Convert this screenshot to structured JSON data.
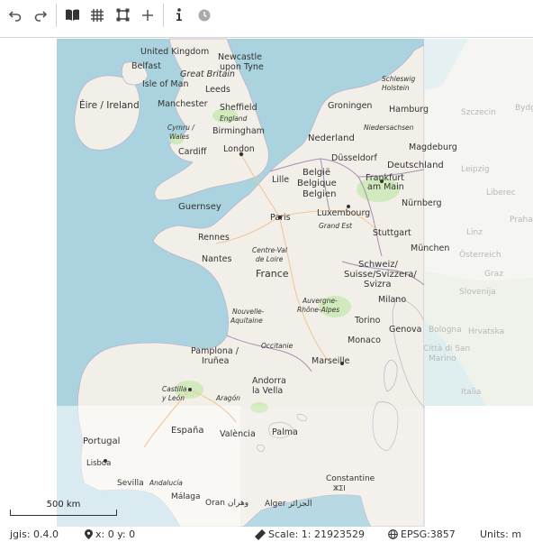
{
  "toolbar": {
    "buttons": [
      {
        "name": "undo-button",
        "icon": "undo-icon"
      },
      {
        "name": "redo-button",
        "icon": "redo-icon"
      },
      {
        "name": "layers-button",
        "icon": "book-open-icon"
      },
      {
        "name": "grid-button",
        "icon": "grid-icon"
      },
      {
        "name": "bounding-box-button",
        "icon": "vector-square-icon"
      },
      {
        "name": "add-button",
        "icon": "plus-icon"
      },
      {
        "name": "info-button",
        "icon": "info-icon"
      },
      {
        "name": "history-button",
        "icon": "clock-icon"
      }
    ]
  },
  "map": {
    "place_labels": {
      "united_kingdom": "United Kingdom",
      "great_britain": "Great Britain",
      "belfast": "Belfast",
      "newcastle": "Newcastle",
      "upon_tyne": "upon Tyne",
      "isle_of_man": "Isle of Man",
      "leeds": "Leeds",
      "eire": "Éire / Ireland",
      "manchester": "Manchester",
      "sheffield": "Sheffield",
      "england": "England",
      "cymru": "Cymru /",
      "wales": "Wales",
      "birmingham": "Birmingham",
      "cardiff": "Cardiff",
      "london": "London",
      "schleswig": "Schleswig",
      "holstein": "Holstein",
      "groningen": "Groningen",
      "hamburg": "Hamburg",
      "niedersachsen": "Niedersachsen",
      "nederland": "Nederland",
      "magdeburg": "Magdeburg",
      "dusseldorf": "Düsseldorf",
      "deutschland": "Deutschland",
      "belgie1": "België",
      "belgie2": "Belgique",
      "belgie3": "Belgien",
      "lille": "Lille",
      "frankfurt": "Frankfurt",
      "am_main": "am Main",
      "guernsey": "Guernsey",
      "paris": "Paris",
      "luxembourg": "Luxembourg",
      "nurnberg": "Nürnberg",
      "grand_est": "Grand Est",
      "rennes": "Rennes",
      "stuttgart": "Stuttgart",
      "centre1": "Centre-Val",
      "centre2": "de Loire",
      "munchen": "München",
      "nantes": "Nantes",
      "schweiz1": "Schweiz/",
      "schweiz2": "Suisse/Svizzera/",
      "schweiz3": "Svizra",
      "france": "France",
      "auvergne1": "Auvergne-",
      "auvergne2": "Rhône-Alpes",
      "milano": "Milano",
      "nouvelle1": "Nouvelle-",
      "nouvelle2": "Aquitaine",
      "torino": "Torino",
      "monaco": "Monaco",
      "genova": "Genova",
      "occitanie": "Occitanie",
      "pamplona": "Pamplona /",
      "irunea": "Iruñea",
      "marseille": "Marseille",
      "andorra1": "Andorra",
      "andorra2": "la Vella",
      "castilla1": "Castilla",
      "castilla2": "y León",
      "aragon": "Aragón",
      "espana": "España",
      "portugal": "Portugal",
      "lisboa": "Lisboa",
      "valencia": "València",
      "palma": "Palma",
      "sevilla": "Sevilla",
      "andalucia": "Andalucía",
      "malaga": "Málaga",
      "oran": "Oran وهران",
      "alger": "Alger الجزائر",
      "constantine1": "Constantine",
      "constantine2": "ⵣⵉⵏ",
      "leipzig": "Leipzig",
      "stettin": "Szczecin",
      "liberec": "Liberec",
      "linz": "Linz",
      "osterreich": "Österreich",
      "graz": "Graz",
      "slovenija": "Slovenija",
      "bologna": "Bologna",
      "hrvatska": "Hrvatska",
      "san_marino1": "Città di San",
      "san_marino2": "Marino",
      "italia": "Italia",
      "bydgoszcz": "Bydgoszcz",
      "praha": "Praha"
    }
  },
  "scale_bar": {
    "label": "500 km"
  },
  "status": {
    "version": "jgis: 0.4.0",
    "coords": "x: 0 y: 0",
    "scale": "Scale: 1: 21923529",
    "projection": "EPSG:3857",
    "units": "Units: m"
  }
}
